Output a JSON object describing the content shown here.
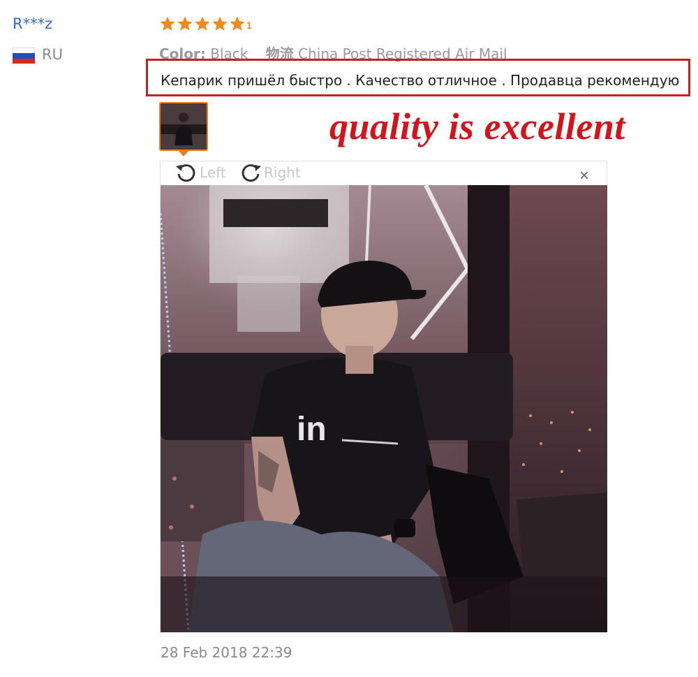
{
  "reviewer": {
    "name": "R***z",
    "country": "RU",
    "flag_colors": [
      "#ffffff",
      "#1f4fb5",
      "#d52b1e"
    ]
  },
  "rating": {
    "value": 5,
    "max": 5,
    "star_color": "#f08a1c",
    "tail_text": "1"
  },
  "order_info": {
    "color_label": "Color:",
    "color_value": "Black",
    "shipping_label": "物流",
    "shipping_value": "China Post Registered Air Mail"
  },
  "review": {
    "text": "Кепарик пришёл быстро . Качество отличное . Продавца рекомендую",
    "highlight_color": "#c81e1e"
  },
  "annotation": {
    "text": "quality is excellent",
    "color": "#d4141c"
  },
  "viewer": {
    "rotate_left_label": "Left",
    "rotate_right_label": "Right",
    "close_symbol": "×",
    "photo_description_icon": "review-photo"
  },
  "review_date": "28 Feb 2018 22:39",
  "accent_color": "#f07c1a"
}
